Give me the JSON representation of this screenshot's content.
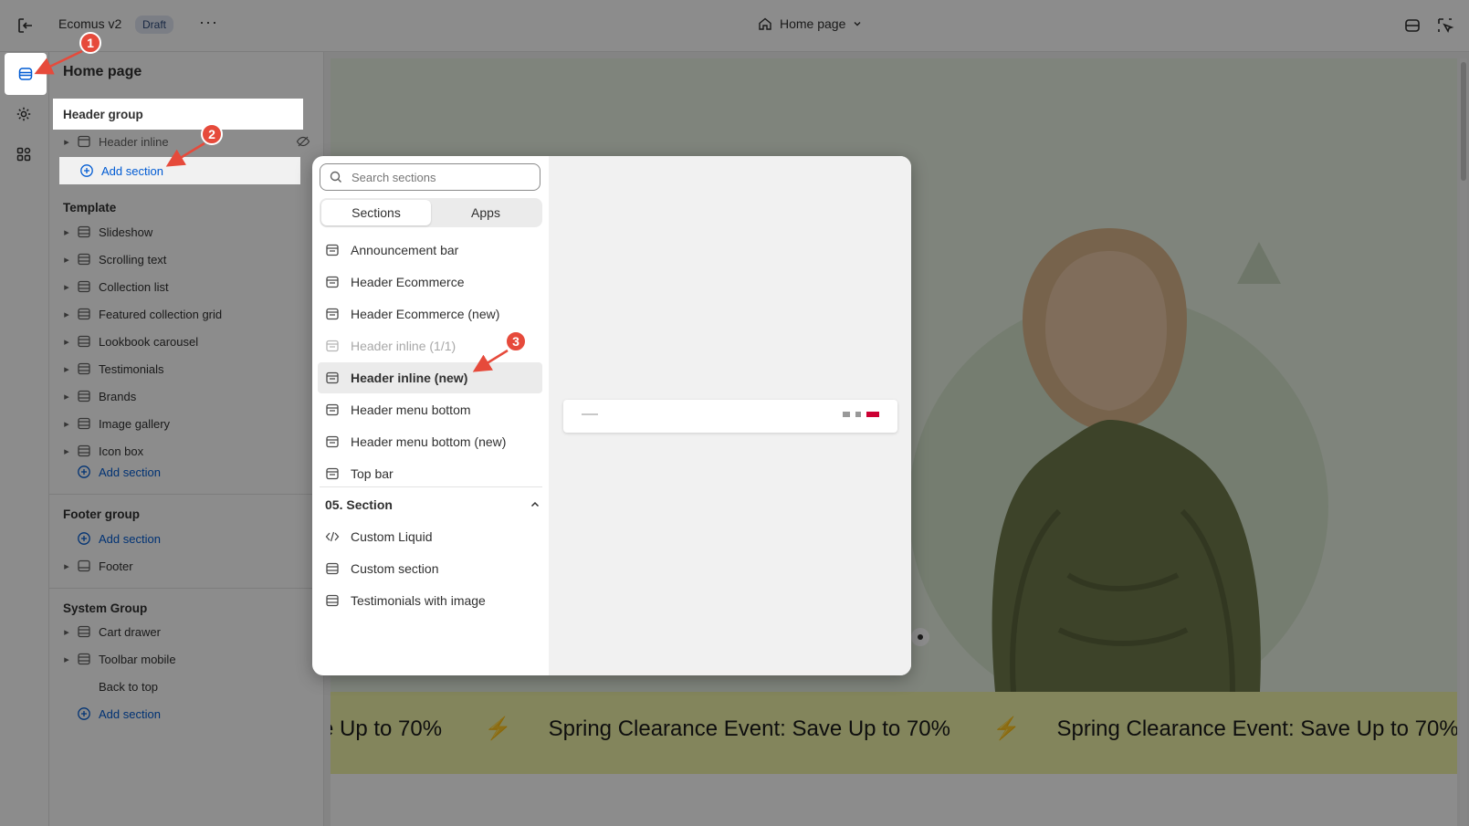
{
  "topbar": {
    "store_name": "Ecomus v2",
    "status_badge": "Draft",
    "more_label": "···",
    "page_selector": "Home page"
  },
  "sidebar": {
    "title": "Home page",
    "header_group": {
      "title": "Header group",
      "items": [
        "Header inline"
      ],
      "add_label": "Add section"
    },
    "template": {
      "title": "Template",
      "items": [
        "Slideshow",
        "Scrolling text",
        "Collection list",
        "Featured collection grid",
        "Lookbook carousel",
        "Testimonials",
        "Brands",
        "Image gallery",
        "Icon box"
      ],
      "add_label": "Add section"
    },
    "footer_group": {
      "title": "Footer group",
      "add_label": "Add section",
      "items": [
        "Footer"
      ]
    },
    "system_group": {
      "title": "System Group",
      "items": [
        "Cart drawer",
        "Toolbar mobile",
        "Back to top"
      ],
      "add_label": "Add section"
    }
  },
  "popup": {
    "search_placeholder": "Search sections",
    "tabs": [
      "Sections",
      "Apps"
    ],
    "items": [
      "Announcement bar",
      "Header Ecommerce",
      "Header Ecommerce (new)",
      "Header inline (1/1)",
      "Header inline (new)",
      "Header menu bottom",
      "Header menu bottom (new)",
      "Top bar"
    ],
    "category": "05. Section",
    "category_items": [
      "Custom Liquid",
      "Custom section",
      "Testimonials with image"
    ]
  },
  "preview": {
    "marquee_text": "Spring Clearance Event: Save Up to 70%",
    "marquee_partial": "e Up to 70%"
  },
  "annotations": [
    "1",
    "2",
    "3"
  ],
  "colors": {
    "accent": "#005bd3",
    "marker": "#e64a3b",
    "marquee_bg": "#eef2a8",
    "hero_bg": "#e8f0e2"
  }
}
